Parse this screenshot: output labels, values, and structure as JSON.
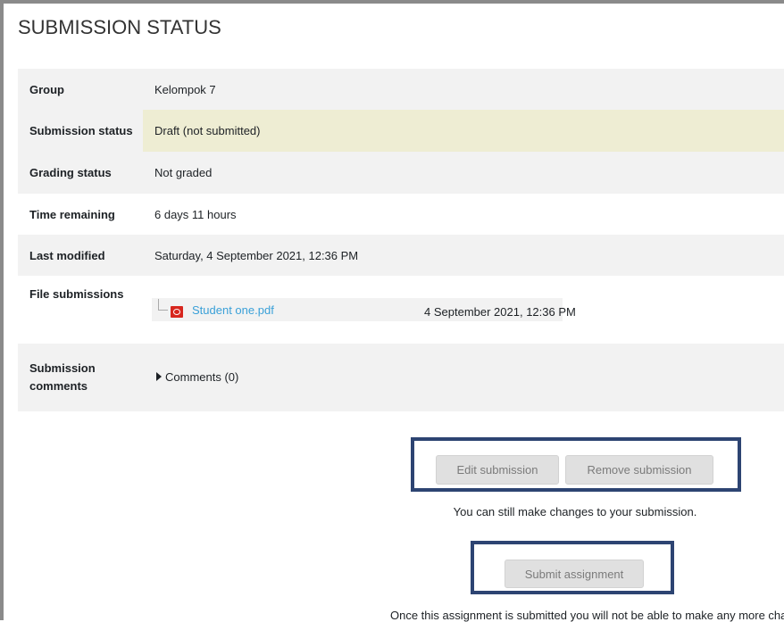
{
  "page": {
    "title": "SUBMISSION STATUS"
  },
  "status_table": {
    "group": {
      "label": "Group",
      "value": "Kelompok 7"
    },
    "submission_status": {
      "label": "Submission status",
      "value": "Draft (not submitted)"
    },
    "grading_status": {
      "label": "Grading status",
      "value": "Not graded"
    },
    "time_remaining": {
      "label": "Time remaining",
      "value": "6 days 11 hours"
    },
    "last_modified": {
      "label": "Last modified",
      "value": "Saturday, 4 September 2021, 12:36 PM"
    },
    "file_submissions": {
      "label": "File submissions",
      "file_name": "Student one.pdf",
      "file_date": "4 September 2021, 12:36 PM",
      "icon": "pdf-icon"
    },
    "submission_comments": {
      "label_line1": "Submission",
      "label_line2": "comments",
      "toggle": "Comments (0)"
    }
  },
  "actions": {
    "edit_label": "Edit submission",
    "remove_label": "Remove submission",
    "edit_note": "You can still make changes to your submission.",
    "submit_label": "Submit assignment",
    "submit_note": "Once this assignment is submitted you will not be able to make any more changes"
  },
  "colors": {
    "highlight_border": "#2d4472",
    "link": "#3aa0d8",
    "draft_background": "#eeedd3"
  }
}
